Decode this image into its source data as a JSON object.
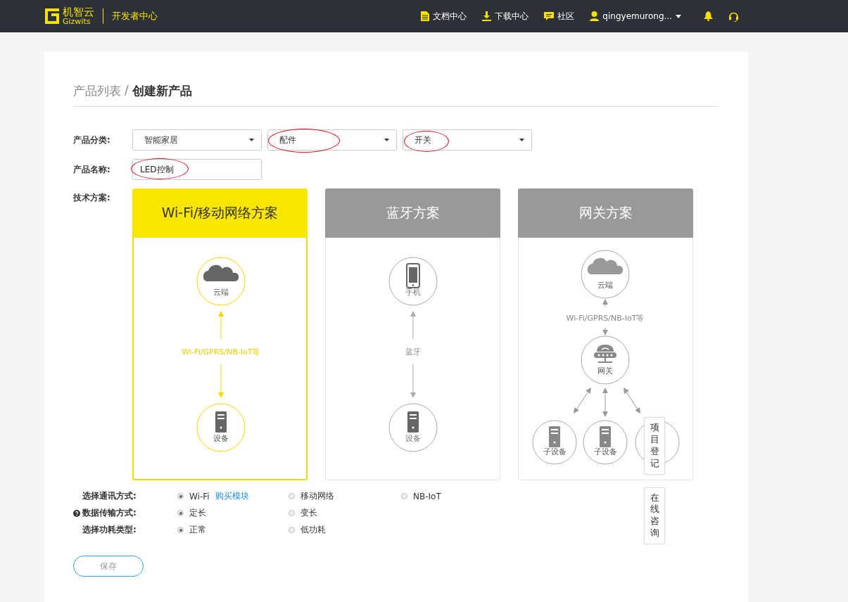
{
  "header": {
    "logo_text": "机智云",
    "logo_sub": "Gizwits",
    "section": "开发者中心",
    "nav": [
      {
        "kind": "doc",
        "label": "文档中心"
      },
      {
        "kind": "download",
        "label": "下载中心"
      },
      {
        "kind": "chat",
        "label": "社区"
      }
    ],
    "user": "qingyemurong..."
  },
  "breadcrumb": {
    "parent": "产品列表",
    "separator": "/",
    "current": "创建新产品"
  },
  "form": {
    "category_label": "产品分类:",
    "selects": [
      {
        "value": "智能家居",
        "annotated": false
      },
      {
        "value": "配件",
        "annotated": true
      },
      {
        "value": "开关",
        "annotated": true
      }
    ],
    "name_label": "产品名称:",
    "name_value": "LED控制",
    "name_annotated": true,
    "tech_label": "技术方案:"
  },
  "schemes": [
    {
      "kind": "pair",
      "title": "Wi-Fi/移动网络方案",
      "selected": true,
      "top": {
        "kind": "cloud",
        "label": "云端"
      },
      "link": "Wi-Fi/GPRS/NB-IoT等",
      "bottom": {
        "kind": "server",
        "label": "设备"
      }
    },
    {
      "kind": "pair",
      "title": "蓝牙方案",
      "selected": false,
      "top": {
        "kind": "phone",
        "label": "手机"
      },
      "link": "蓝牙",
      "bottom": {
        "kind": "server",
        "label": "设备"
      }
    },
    {
      "kind": "gateway",
      "title": "网关方案",
      "selected": false,
      "top": {
        "kind": "cloud",
        "label": "云端"
      },
      "link": "Wi-Fi/GPRS/NB-IoT等",
      "middle": {
        "kind": "router",
        "label": "网关"
      },
      "children": [
        {
          "kind": "server",
          "label": "子设备"
        },
        {
          "kind": "server",
          "label": "子设备"
        },
        {
          "kind": "covered"
        }
      ]
    }
  ],
  "options": [
    {
      "label": "选择通讯方式:",
      "help": false,
      "choices": [
        {
          "label": "Wi-Fi",
          "link": "购买模块",
          "selected": true
        },
        {
          "label": "移动网络",
          "selected": false
        },
        {
          "label": "NB-IoT",
          "selected": false
        }
      ]
    },
    {
      "label": "数据传输方式:",
      "help": true,
      "choices": [
        {
          "label": "定长",
          "selected": true
        },
        {
          "label": "变长",
          "selected": false
        }
      ]
    },
    {
      "label": "选择功耗类型:",
      "help": false,
      "choices": [
        {
          "label": "正常",
          "selected": true
        },
        {
          "label": "低功耗",
          "selected": false
        }
      ]
    }
  ],
  "save": "保存",
  "floats": [
    "项目登记",
    "在线咨询"
  ]
}
